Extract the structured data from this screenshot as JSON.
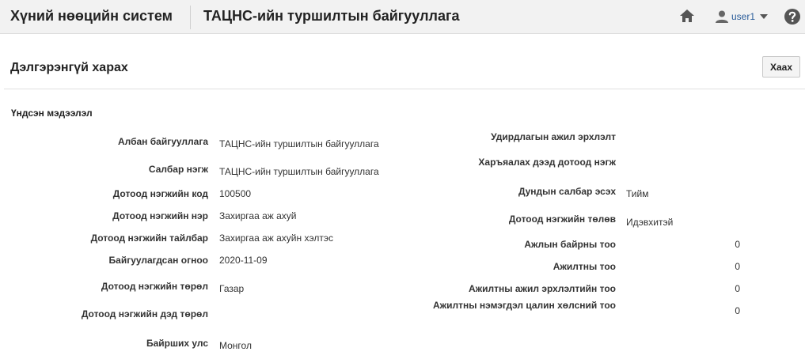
{
  "header": {
    "app_title": "Хүний нөөцийн систем",
    "org_title": "ТАЦНС-ийн туршилтын байгууллага",
    "user": "user1"
  },
  "panel": {
    "title": "Дэлгэрэнгүй харах",
    "close_label": "Хаах",
    "section_title": "Үндсэн мэдээлэл"
  },
  "left_fields": [
    {
      "label": "Албан байгууллага",
      "value": "ТАЦНС-ийн туршилтын байгууллага"
    },
    {
      "label": "Салбар нэгж",
      "value": "ТАЦНС-ийн туршилтын байгууллага"
    },
    {
      "label": "Дотоод нэгжийн код",
      "value": "100500"
    },
    {
      "label": "Дотоод нэгжийн нэр",
      "value": "Захиргаа аж ахуй"
    },
    {
      "label": "Дотоод нэгжийн тайлбар",
      "value": "Захиргаа аж ахуйн хэлтэс"
    },
    {
      "label": "Байгуулагдсан огноо",
      "value": "2020-11-09"
    },
    {
      "label": "Дотоод нэгжийн төрөл",
      "value": "Газар"
    },
    {
      "label": "Дотоод нэгжийн дэд төрөл",
      "value": ""
    },
    {
      "label": "Байрших улс",
      "value": "Монгол"
    }
  ],
  "right_fields": [
    {
      "label": "Удирдлагын ажил эрхлэлт",
      "value": ""
    },
    {
      "label": "Харъяалах дээд дотоод нэгж",
      "value": ""
    },
    {
      "label": "Дундын салбар эсэх",
      "value": "Тийм"
    },
    {
      "label": "Дотоод нэгжийн төлөв",
      "value": "Идэвхитэй"
    },
    {
      "label": "Ажлын байрны тоо",
      "value": "0"
    },
    {
      "label": "Ажилтны тоо",
      "value": "0"
    },
    {
      "label": "Ажилтны ажил эрхлэлтийн тоо",
      "value": "0"
    },
    {
      "label": "Ажилтны нэмэгдэл цалин хөлсний тоо",
      "value": "0"
    }
  ]
}
